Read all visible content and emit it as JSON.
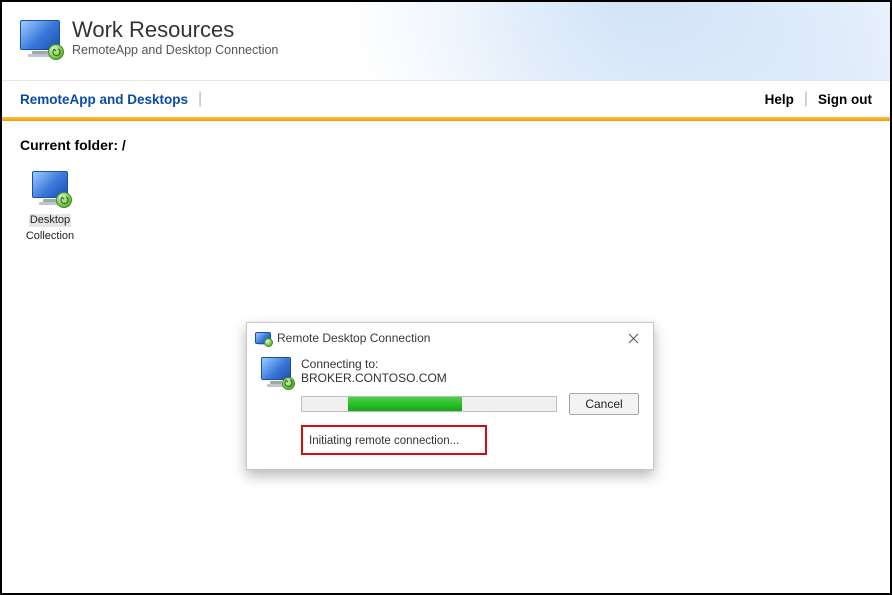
{
  "header": {
    "title": "Work Resources",
    "subtitle": "RemoteApp and Desktop Connection"
  },
  "nav": {
    "tab_remoteapp": "RemoteApp and Desktops",
    "help": "Help",
    "signout": "Sign out"
  },
  "content": {
    "current_folder_label": "Current folder: /",
    "item_line1": "Desktop",
    "item_line2": "Collection"
  },
  "dialog": {
    "title": "Remote Desktop Connection",
    "connecting_label": "Connecting to:",
    "host": "BROKER.CONTOSO.COM",
    "cancel": "Cancel",
    "status": "Initiating remote connection...",
    "progress_left_pct": 18,
    "progress_width_pct": 45
  },
  "icons": {
    "brand": "remote-desktop-monitor-icon",
    "folder_item": "remote-desktop-monitor-icon",
    "dialog_title": "remote-desktop-monitor-icon",
    "dialog_body": "remote-desktop-monitor-icon",
    "close": "close-icon"
  }
}
